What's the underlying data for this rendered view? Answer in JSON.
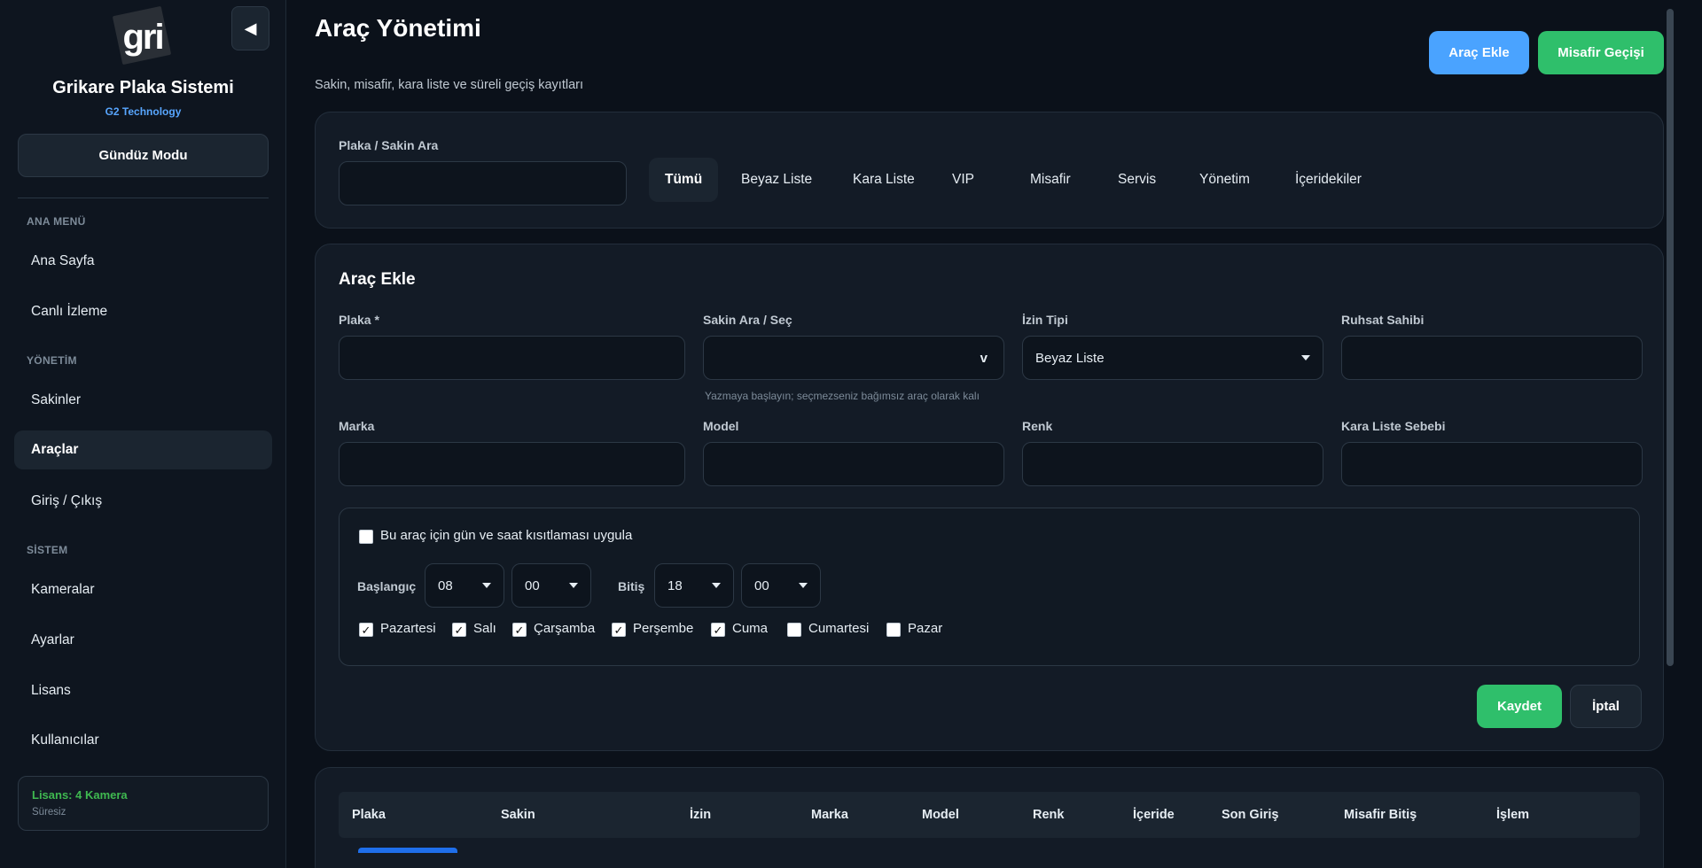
{
  "sidebar": {
    "logo_text": "gri",
    "brand_name": "Grikare Plaka Sistemi",
    "brand_sub": "G2 Technology",
    "collapse_icon": "◀",
    "mode_button": "Gündüz Modu",
    "sections": {
      "main": "ANA MENÜ",
      "management": "YÖNETİM",
      "system": "SİSTEM"
    },
    "items": {
      "home": "Ana Sayfa",
      "live": "Canlı İzleme",
      "residents": "Sakinler",
      "vehicles": "Araçlar",
      "entry_exit": "Giriş / Çıkış",
      "cameras": "Kameralar",
      "settings": "Ayarlar",
      "license": "Lisans",
      "users": "Kullanıcılar"
    },
    "license_box": {
      "title": "Lisans: 4 Kamera",
      "sub": "Süresiz"
    }
  },
  "header": {
    "title": "Araç Yönetimi",
    "subtitle": "Sakin, misafir, kara liste ve süreli geçiş kayıtları",
    "add_vehicle": "Araç Ekle",
    "guest_pass": "Misafir Geçişi"
  },
  "filter": {
    "search_label": "Plaka / Sakin Ara",
    "search_value": "",
    "tabs": [
      "Tümü",
      "Beyaz Liste",
      "Kara Liste",
      "VIP",
      "Misafir",
      "Servis",
      "Yönetim",
      "İçeridekiler"
    ]
  },
  "form": {
    "title": "Araç Ekle",
    "plate_label": "Plaka *",
    "resident_label": "Sakin Ara / Seç",
    "resident_hint": "Yazmaya başlayın; seçmezseniz bağımsız araç olarak kalı",
    "resident_caret": "v",
    "permit_label": "İzin Tipi",
    "permit_value": "Beyaz Liste",
    "owner_label": "Ruhsat Sahibi",
    "brand_label": "Marka",
    "model_label": "Model",
    "color_label": "Renk",
    "blacklist_reason_label": "Kara Liste Sebebi",
    "restriction": {
      "enable_label": "Bu araç için gün ve saat kısıtlaması uygula",
      "enabled": false,
      "start_label": "Başlangıç",
      "start_hour": "08",
      "start_minute": "00",
      "end_label": "Bitiş",
      "end_hour": "18",
      "end_minute": "00",
      "days": {
        "mon": "Pazartesi",
        "tue": "Salı",
        "wed": "Çarşamba",
        "thu": "Perşembe",
        "fri": "Cuma",
        "sat": "Cumartesi",
        "sun": "Pazar"
      },
      "check_mark": "✓"
    },
    "save": "Kaydet",
    "cancel": "İptal"
  },
  "table": {
    "columns": [
      "Plaka",
      "Sakin",
      "İzin",
      "Marka",
      "Model",
      "Renk",
      "İçeride",
      "Son Giriş",
      "Misafir Bitiş",
      "İşlem"
    ]
  }
}
